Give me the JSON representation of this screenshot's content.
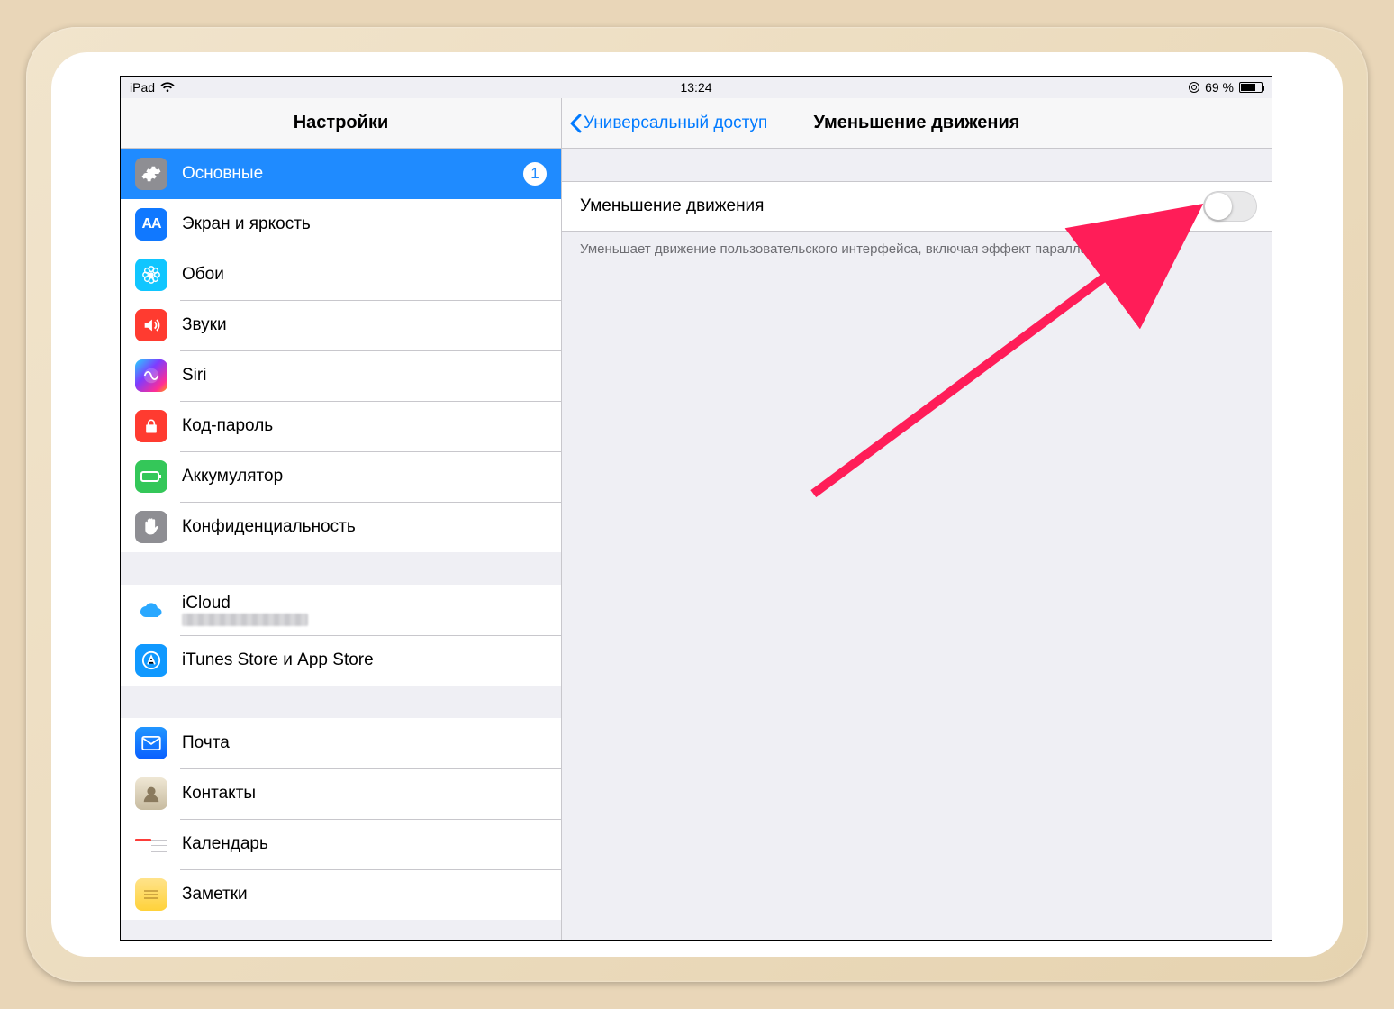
{
  "status": {
    "carrier": "iPad",
    "time": "13:24",
    "battery_text": "69 %"
  },
  "sidebar": {
    "title": "Настройки",
    "groups": [
      [
        {
          "label": "Основные",
          "icon": "gear",
          "bg": "bg-gray",
          "selected": true,
          "badge": "1"
        },
        {
          "label": "Экран и яркость",
          "icon": "aA",
          "bg": "bg-blue"
        },
        {
          "label": "Обои",
          "icon": "flower",
          "bg": "bg-cyan"
        },
        {
          "label": "Звуки",
          "icon": "speaker",
          "bg": "bg-red"
        },
        {
          "label": "Siri",
          "icon": "siri",
          "bg": "bg-siri"
        },
        {
          "label": "Код-пароль",
          "icon": "lock",
          "bg": "bg-red"
        },
        {
          "label": "Аккумулятор",
          "icon": "battery",
          "bg": "bg-green"
        },
        {
          "label": "Конфиденциальность",
          "icon": "hand",
          "bg": "bg-handgray"
        }
      ],
      [
        {
          "label": "iCloud",
          "icon": "cloud",
          "bg": "bg-cloud",
          "sub_blur": true
        },
        {
          "label": "iTunes Store и App Store",
          "icon": "appstore",
          "bg": "bg-appstore"
        }
      ],
      [
        {
          "label": "Почта",
          "icon": "mail",
          "bg": "bg-mail"
        },
        {
          "label": "Контакты",
          "icon": "contacts",
          "bg": "bg-contacts"
        },
        {
          "label": "Календарь",
          "icon": "calendar",
          "bg": "bg-calendar"
        },
        {
          "label": "Заметки",
          "icon": "notes",
          "bg": "bg-notes"
        }
      ]
    ]
  },
  "detail": {
    "back_label": "Универсальный доступ",
    "title": "Уменьшение движения",
    "toggle_label": "Уменьшение движения",
    "footer": "Уменьшает движение пользовательского интерфейса, включая эффект параллакса значков."
  }
}
